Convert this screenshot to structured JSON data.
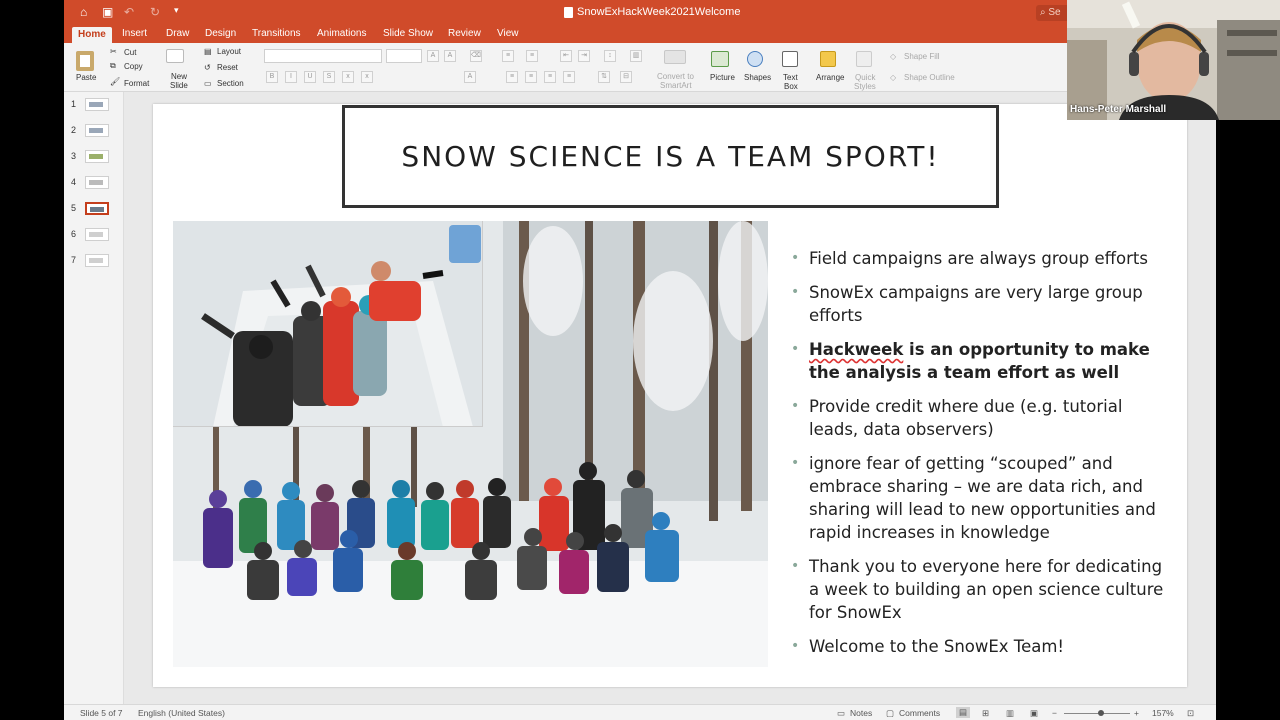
{
  "window": {
    "doc_title": "SnowExHackWeek2021Welcome",
    "search_label": "Se"
  },
  "ribbon_tabs": [
    "Home",
    "Insert",
    "Draw",
    "Design",
    "Transitions",
    "Animations",
    "Slide Show",
    "Review",
    "View"
  ],
  "ribbon": {
    "paste": "Paste",
    "cut": "Cut",
    "copy": "Copy",
    "format": "Format",
    "new_slide_1": "New",
    "new_slide_2": "Slide",
    "layout": "Layout",
    "reset": "Reset",
    "section": "Section",
    "convert_1": "Convert to",
    "convert_2": "SmartArt",
    "picture": "Picture",
    "shapes": "Shapes",
    "text_box_1": "Text",
    "text_box_2": "Box",
    "arrange": "Arrange",
    "quick_styles_1": "Quick",
    "quick_styles_2": "Styles",
    "shape_fill": "Shape Fill",
    "shape_outline": "Shape Outline"
  },
  "thumbnails": [
    "1",
    "2",
    "3",
    "4",
    "5",
    "6",
    "7"
  ],
  "slide": {
    "title": "SNOW SCIENCE IS A TEAM SPORT!",
    "bullets": [
      {
        "text": "Field campaigns are always group efforts"
      },
      {
        "text": "SnowEx campaigns are very large group efforts"
      },
      {
        "bold_word": "Hackweek",
        "text": " is an opportunity to make the analysis a team effort as well"
      },
      {
        "text": "Provide credit where due (e.g. tutorial leads, data observers)"
      },
      {
        "text": "ignore fear of getting “scouped” and embrace sharing – we are data rich, and sharing will lead to new opportunities and rapid increases in knowledge"
      },
      {
        "text": "Thank you to everyone here for dedicating a week to building an open science culture for SnowEx"
      },
      {
        "text": "Welcome to the SnowEx Team!"
      }
    ]
  },
  "status": {
    "slide_of": "Slide 5 of 7",
    "language": "English (United States)",
    "notes": "Notes",
    "comments": "Comments",
    "zoom": "157%"
  },
  "video": {
    "participant_name": "Hans-Peter Marshall"
  },
  "colors": {
    "accent": "#d04b2a",
    "selected_thumb": "#c43e1c"
  }
}
